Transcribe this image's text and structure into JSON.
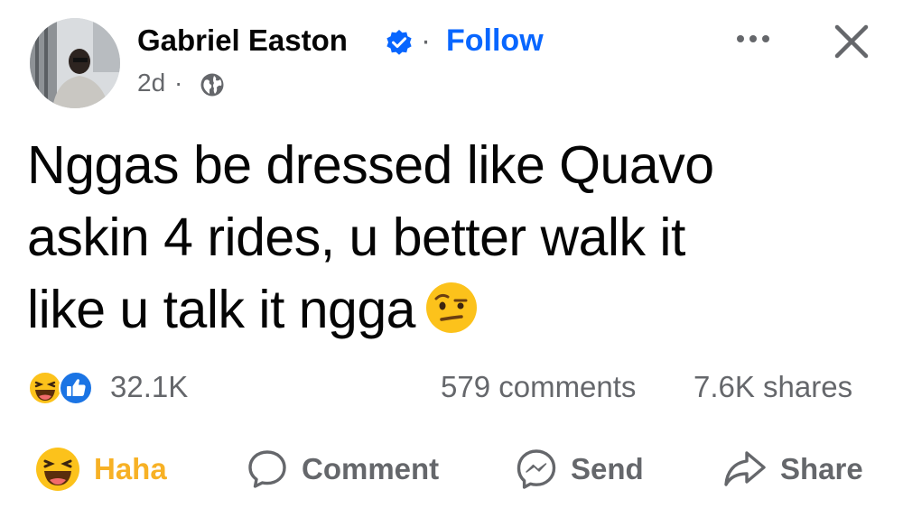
{
  "header": {
    "author": "Gabriel Easton",
    "follow_label": "Follow",
    "separator": "·",
    "time": "2d",
    "meta_dot": "·"
  },
  "post": {
    "lines": [
      "Nggas be dressed like Quavo",
      "askin 4 rides, u better walk it",
      "like u talk it ngga"
    ],
    "emoji": "raised-eyebrow-emoji"
  },
  "stats": {
    "reactions_count": "32.1K",
    "comments": "579 comments",
    "shares": "7.6K shares"
  },
  "actions": {
    "haha_label": "Haha",
    "comment_label": "Comment",
    "send_label": "Send",
    "share_label": "Share"
  },
  "colors": {
    "follow_blue": "#0866ff",
    "haha_yellow": "#f7b125",
    "secondary_text": "#65676b",
    "verified_blue": "#0866ff"
  },
  "icons": [
    "verified-badge-icon",
    "globe-icon",
    "more-options-icon",
    "close-icon",
    "haha-reaction-icon",
    "like-reaction-icon",
    "comment-icon",
    "messenger-icon",
    "share-arrow-icon"
  ]
}
